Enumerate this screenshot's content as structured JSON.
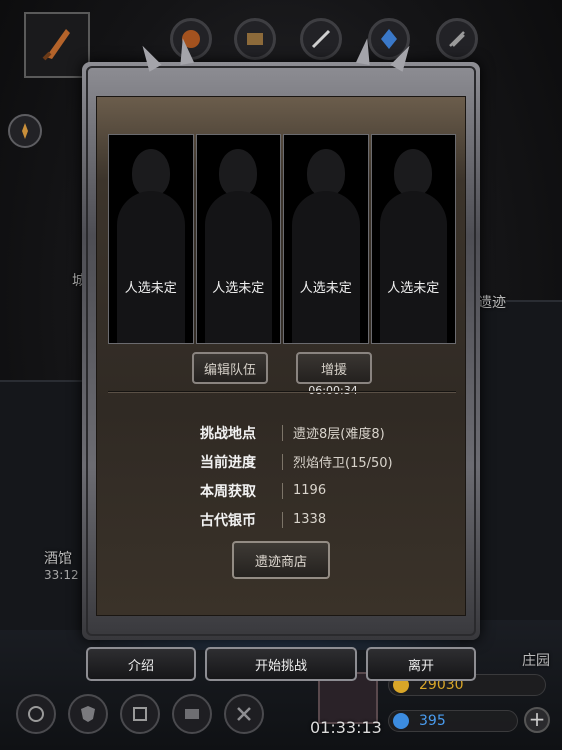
{
  "background": {
    "left_label": "城",
    "right_label": "遗迹",
    "tavern": {
      "name": "酒馆",
      "time": "33:12"
    },
    "manor": "庄园",
    "gold": "29030",
    "gems": "395",
    "bottom_timer": "01:33:13",
    "top_icons": [
      "sword-icon",
      "fire-guild-icon",
      "scroll-icon",
      "blade-icon",
      "blue-crystal-icon",
      "dark-blade-icon"
    ],
    "bottom_icons": [
      "rune-icon",
      "shield-icon",
      "gate-icon",
      "book-icon",
      "tools-icon"
    ]
  },
  "dialog": {
    "slots": [
      {
        "label": "人选未定"
      },
      {
        "label": "人选未定"
      },
      {
        "label": "人选未定"
      },
      {
        "label": "人选未定"
      }
    ],
    "edit_team": "编辑队伍",
    "reinforce": "增援",
    "reinforce_timer": "06:00:34",
    "info": [
      {
        "key": "挑战地点",
        "value": "遗迹8层(难度8)"
      },
      {
        "key": "当前进度",
        "value": "烈焰侍卫(15/50)"
      },
      {
        "key": "本周获取",
        "value": "1196"
      },
      {
        "key": "古代银币",
        "value": "1338"
      }
    ],
    "shop_button": "遗迹商店",
    "intro_button": "介绍",
    "start_button": "开始挑战",
    "leave_button": "离开"
  },
  "colors": {
    "panel_brown": "#3a3229",
    "frame_silver": "#8e8e94",
    "gold_coin": "#d9a628",
    "gem_blue": "#3c8ce0"
  }
}
